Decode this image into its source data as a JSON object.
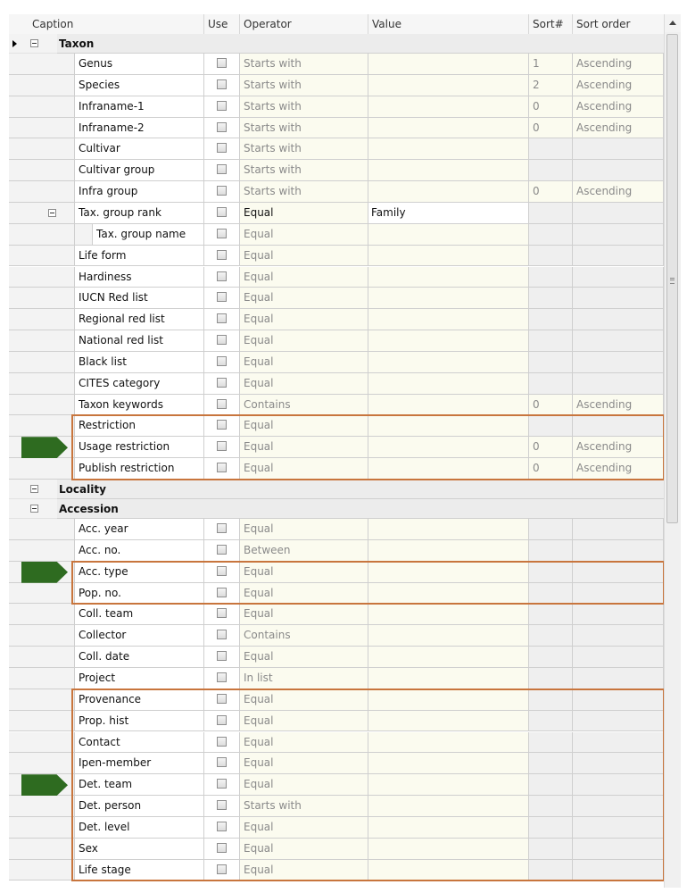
{
  "columns": {
    "caption": "Caption",
    "use": "Use",
    "operator": "Operator",
    "value": "Value",
    "sort_num": "Sort#",
    "sort_order": "Sort order"
  },
  "colors": {
    "highlight_border": "#c8753d",
    "arrow_fill": "#2e6b20",
    "group_band": "#ececec",
    "editable_cell": "#fbfbef"
  },
  "rows": [
    {
      "kind": "group",
      "label": "Taxon",
      "current": true
    },
    {
      "kind": "item",
      "caption": "Genus",
      "operator": "Starts with",
      "value": "",
      "sort_num": "1",
      "sort_order": "Ascending"
    },
    {
      "kind": "item",
      "caption": "Species",
      "operator": "Starts with",
      "value": "",
      "sort_num": "2",
      "sort_order": "Ascending"
    },
    {
      "kind": "item",
      "caption": "Infraname-1",
      "operator": "Starts with",
      "value": "",
      "sort_num": "0",
      "sort_order": "Ascending"
    },
    {
      "kind": "item",
      "caption": "Infraname-2",
      "operator": "Starts with",
      "value": "",
      "sort_num": "0",
      "sort_order": "Ascending"
    },
    {
      "kind": "item",
      "caption": "Cultivar",
      "operator": "Starts with",
      "value": "",
      "sort_num": "",
      "sort_order": ""
    },
    {
      "kind": "item",
      "caption": "Cultivar group",
      "operator": "Starts with",
      "value": "",
      "sort_num": "",
      "sort_order": ""
    },
    {
      "kind": "item",
      "caption": "Infra group",
      "operator": "Starts with",
      "value": "",
      "sort_num": "0",
      "sort_order": "Ascending"
    },
    {
      "kind": "item",
      "caption": "Tax. group rank",
      "operator": "Equal",
      "value": "Family",
      "sort_num": "",
      "sort_order": "",
      "expander": true,
      "active": true
    },
    {
      "kind": "item",
      "caption": "Tax. group name",
      "operator": "Equal",
      "value": "",
      "sort_num": "",
      "sort_order": "",
      "nested": true
    },
    {
      "kind": "item",
      "caption": "Life form",
      "operator": "Equal",
      "value": "",
      "sort_num": "",
      "sort_order": ""
    },
    {
      "kind": "item",
      "caption": "Hardiness",
      "operator": "Equal",
      "value": "",
      "sort_num": "",
      "sort_order": ""
    },
    {
      "kind": "item",
      "caption": "IUCN Red list",
      "operator": "Equal",
      "value": "",
      "sort_num": "",
      "sort_order": ""
    },
    {
      "kind": "item",
      "caption": "Regional red list",
      "operator": "Equal",
      "value": "",
      "sort_num": "",
      "sort_order": ""
    },
    {
      "kind": "item",
      "caption": "National red list",
      "operator": "Equal",
      "value": "",
      "sort_num": "",
      "sort_order": ""
    },
    {
      "kind": "item",
      "caption": "Black list",
      "operator": "Equal",
      "value": "",
      "sort_num": "",
      "sort_order": ""
    },
    {
      "kind": "item",
      "caption": "CITES category",
      "operator": "Equal",
      "value": "",
      "sort_num": "",
      "sort_order": ""
    },
    {
      "kind": "item",
      "caption": "Taxon keywords",
      "operator": "Contains",
      "value": "",
      "sort_num": "0",
      "sort_order": "Ascending"
    },
    {
      "kind": "item",
      "caption": "Restriction",
      "operator": "Equal",
      "value": "",
      "sort_num": "",
      "sort_order": ""
    },
    {
      "kind": "item",
      "caption": "Usage restriction",
      "operator": "Equal",
      "value": "",
      "sort_num": "0",
      "sort_order": "Ascending"
    },
    {
      "kind": "item",
      "caption": "Publish restriction",
      "operator": "Equal",
      "value": "",
      "sort_num": "0",
      "sort_order": "Ascending"
    },
    {
      "kind": "group",
      "label": "Locality"
    },
    {
      "kind": "group",
      "label": "Accession"
    },
    {
      "kind": "item",
      "caption": "Acc. year",
      "operator": "Equal",
      "value": "",
      "sort_num": "",
      "sort_order": ""
    },
    {
      "kind": "item",
      "caption": "Acc. no.",
      "operator": "Between",
      "value": "",
      "sort_num": "",
      "sort_order": ""
    },
    {
      "kind": "item",
      "caption": "Acc. type",
      "operator": "Equal",
      "value": "",
      "sort_num": "",
      "sort_order": ""
    },
    {
      "kind": "item",
      "caption": "Pop. no.",
      "operator": "Equal",
      "value": "",
      "sort_num": "",
      "sort_order": ""
    },
    {
      "kind": "item",
      "caption": "Coll. team",
      "operator": "Equal",
      "value": "",
      "sort_num": "",
      "sort_order": ""
    },
    {
      "kind": "item",
      "caption": "Collector",
      "operator": "Contains",
      "value": "",
      "sort_num": "",
      "sort_order": ""
    },
    {
      "kind": "item",
      "caption": "Coll. date",
      "operator": "Equal",
      "value": "",
      "sort_num": "",
      "sort_order": ""
    },
    {
      "kind": "item",
      "caption": "Project",
      "operator": "In list",
      "value": "",
      "sort_num": "",
      "sort_order": ""
    },
    {
      "kind": "item",
      "caption": "Provenance",
      "operator": "Equal",
      "value": "",
      "sort_num": "",
      "sort_order": ""
    },
    {
      "kind": "item",
      "caption": "Prop. hist",
      "operator": "Equal",
      "value": "",
      "sort_num": "",
      "sort_order": ""
    },
    {
      "kind": "item",
      "caption": "Contact",
      "operator": "Equal",
      "value": "",
      "sort_num": "",
      "sort_order": ""
    },
    {
      "kind": "item",
      "caption": "Ipen-member",
      "operator": "Equal",
      "value": "",
      "sort_num": "",
      "sort_order": ""
    },
    {
      "kind": "item",
      "caption": "Det. team",
      "operator": "Equal",
      "value": "",
      "sort_num": "",
      "sort_order": ""
    },
    {
      "kind": "item",
      "caption": "Det. person",
      "operator": "Starts with",
      "value": "",
      "sort_num": "",
      "sort_order": ""
    },
    {
      "kind": "item",
      "caption": "Det. level",
      "operator": "Equal",
      "value": "",
      "sort_num": "",
      "sort_order": ""
    },
    {
      "kind": "item",
      "caption": "Sex",
      "operator": "Equal",
      "value": "",
      "sort_num": "",
      "sort_order": ""
    },
    {
      "kind": "item",
      "caption": "Life stage",
      "operator": "Equal",
      "value": "",
      "sort_num": "",
      "sort_order": ""
    }
  ],
  "highlight_groups": [
    {
      "first": "Restriction",
      "last": "Publish restriction",
      "arrow_at": "Usage restriction"
    },
    {
      "first": "Acc. type",
      "last": "Pop. no.",
      "arrow_at": "Acc. type"
    },
    {
      "first": "Provenance",
      "last": "Life stage",
      "arrow_at": "Det. team"
    }
  ]
}
